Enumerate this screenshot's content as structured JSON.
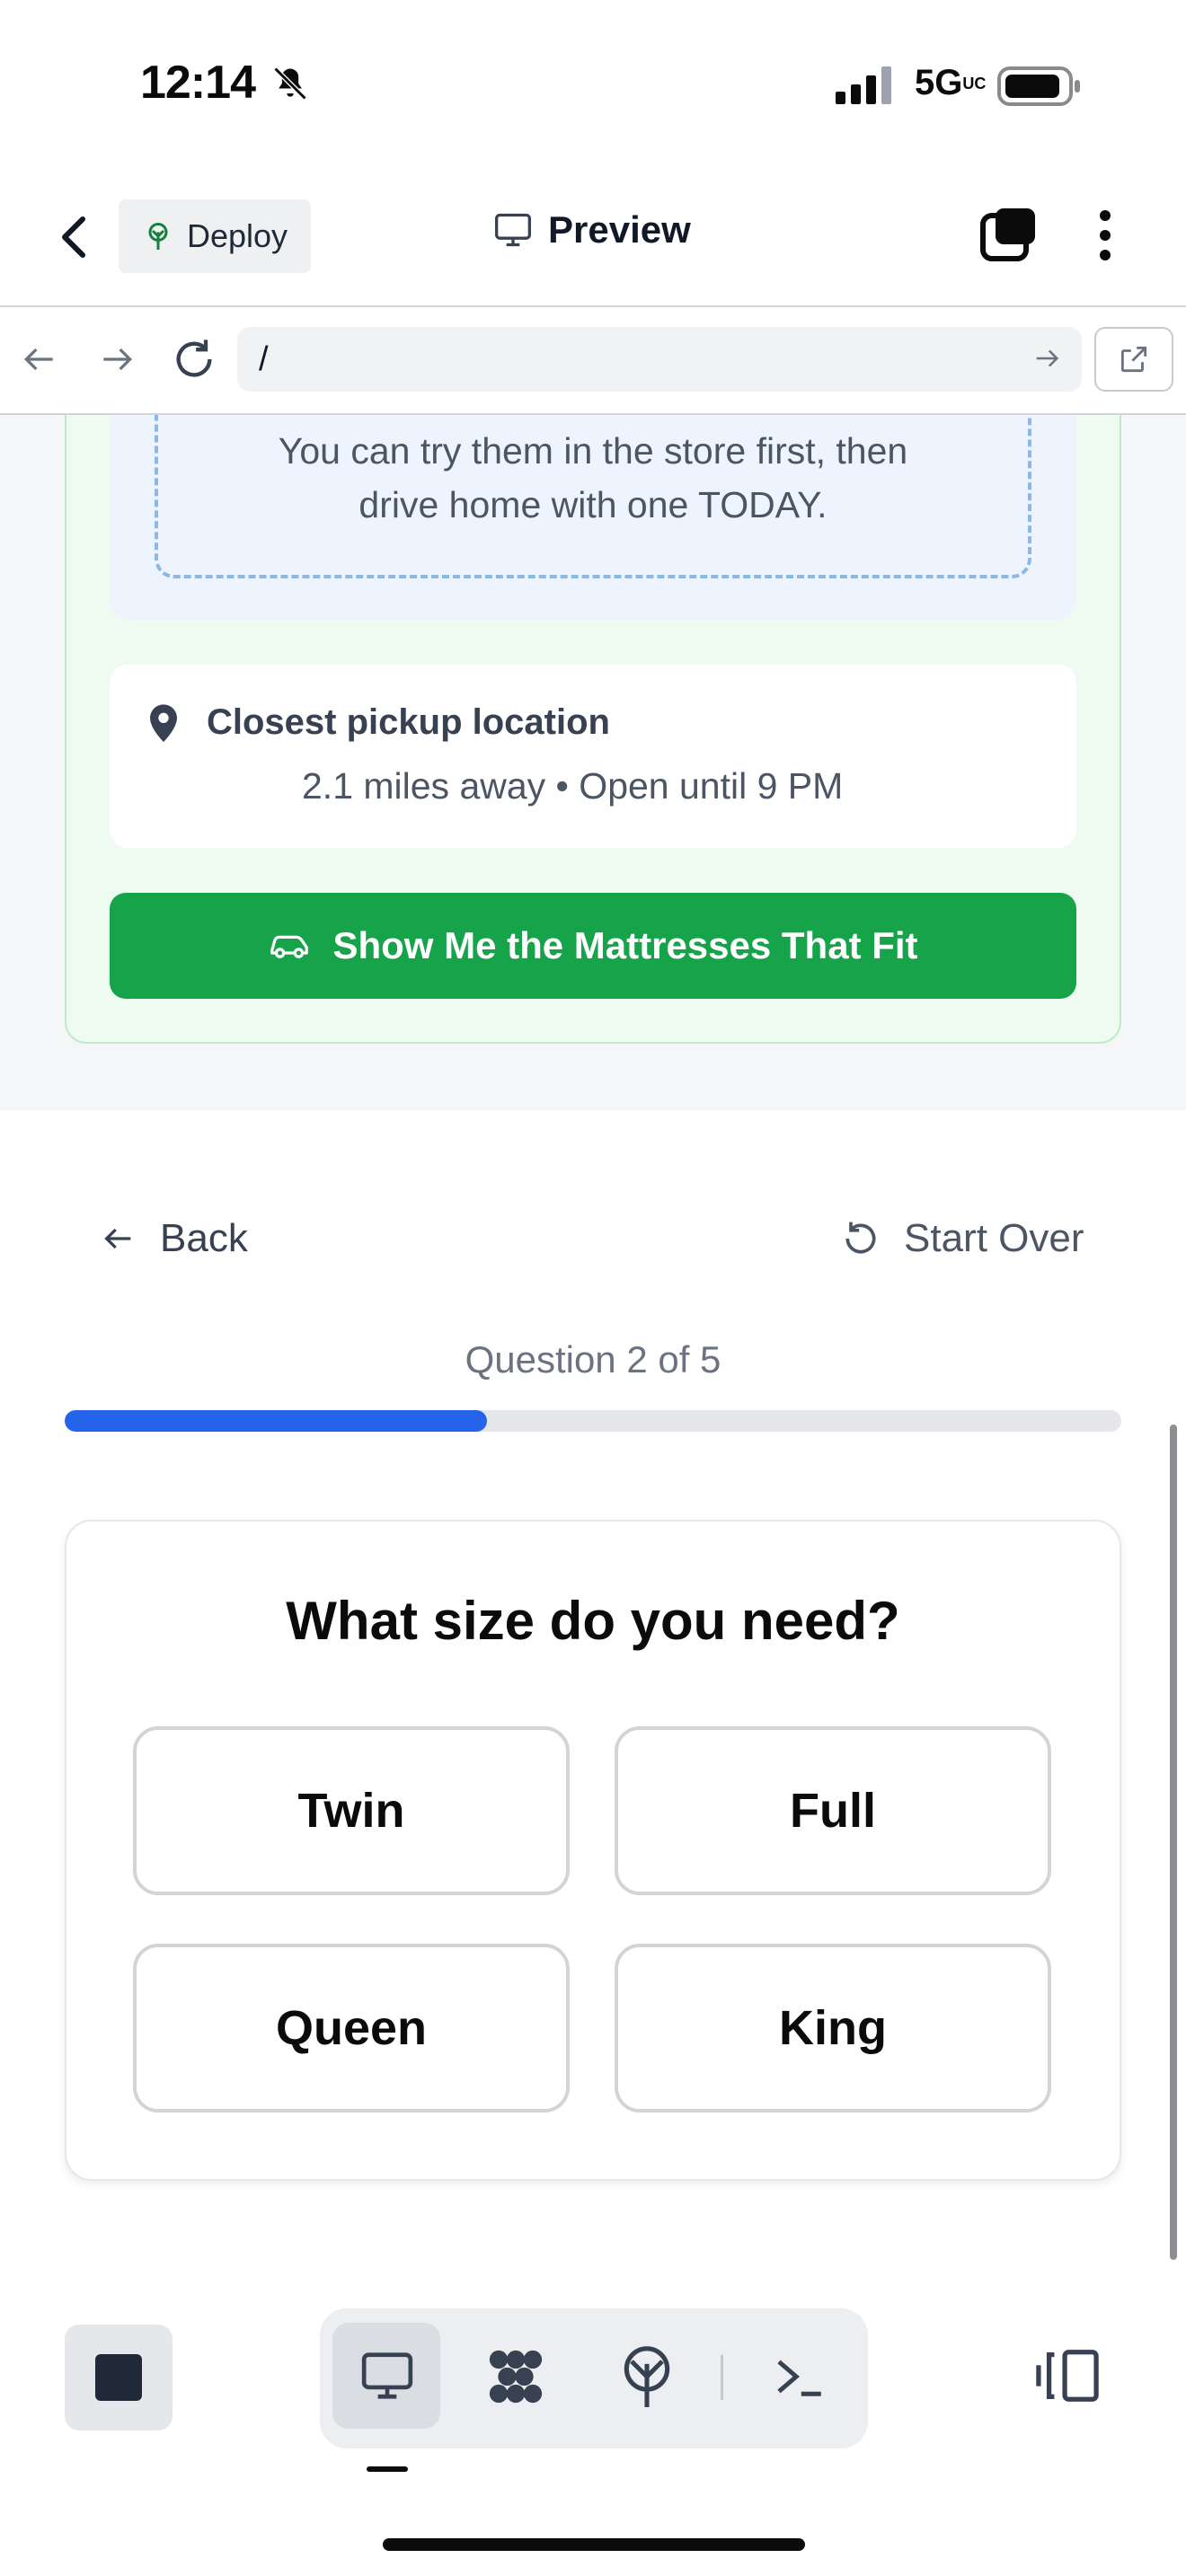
{
  "status_bar": {
    "time": "12:14",
    "network": "5G",
    "network_suffix": "UC"
  },
  "top_bar": {
    "deploy_label": "Deploy",
    "preview_label": "Preview"
  },
  "url_bar": {
    "value": "/"
  },
  "page": {
    "info_box_text_line1": "You can try them in the store first, then",
    "info_box_text_line2": "drive home with one TODAY.",
    "pickup": {
      "title": "Closest pickup location",
      "subtitle": "2.1 miles away • Open until 9 PM"
    },
    "cta_label": "Show Me the Mattresses That Fit",
    "nav": {
      "back_label": "Back",
      "start_over_label": "Start Over"
    },
    "progress": {
      "label": "Question 2 of 5",
      "fraction": 0.4
    },
    "quiz": {
      "question": "What size do you need?",
      "options": [
        "Twin",
        "Full",
        "Queen",
        "King"
      ]
    }
  },
  "colors": {
    "accent_green": "#16a34a",
    "progress_blue": "#2563eb"
  },
  "icons": {
    "back": "chevron-left-icon",
    "deploy": "tree-icon",
    "preview": "monitor-icon",
    "tabs": "tabs-icon",
    "more": "vertical-dots-icon",
    "nav_back": "arrow-left-icon",
    "nav_forward": "arrow-right-icon",
    "reload": "reload-icon",
    "go": "arrow-right-icon",
    "external": "external-link-icon",
    "pin": "map-pin-icon",
    "car": "car-icon",
    "undo": "rotate-ccw-icon"
  }
}
